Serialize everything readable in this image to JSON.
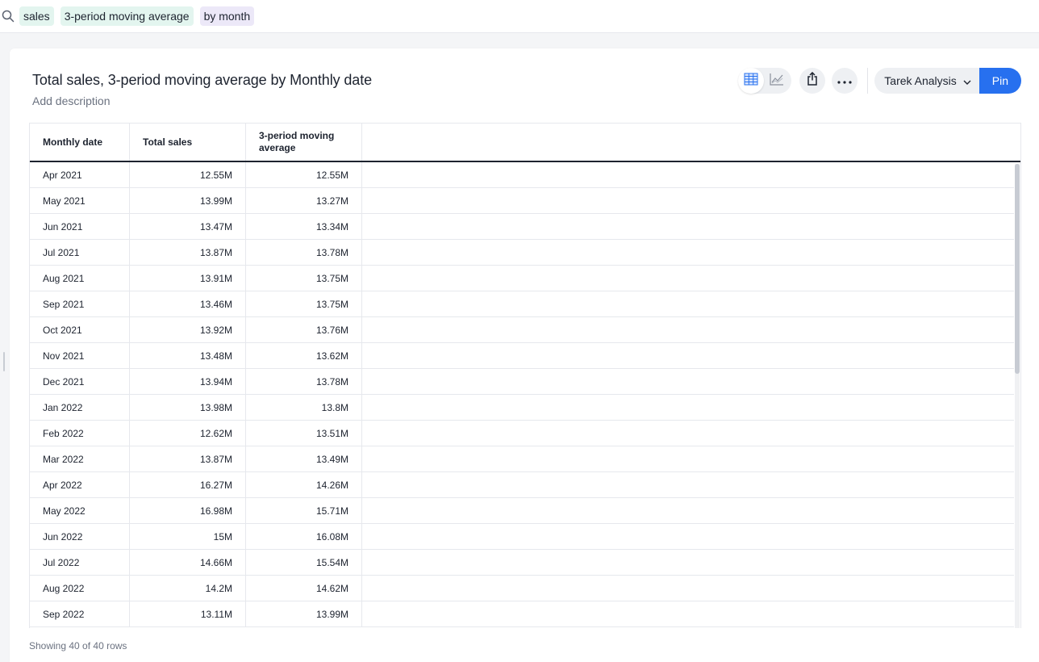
{
  "search": {
    "tokens": [
      {
        "label": "sales",
        "kind": "measure"
      },
      {
        "label": "3-period moving average",
        "kind": "measure"
      },
      {
        "label": "by month",
        "kind": "attribute"
      }
    ]
  },
  "answer": {
    "title": "Total sales, 3-period moving average by Monthly date",
    "description_placeholder": "Add description"
  },
  "toolbar": {
    "table_view_icon": "table-icon",
    "chart_view_icon": "line-chart-icon",
    "share_icon": "share-icon",
    "more_icon": "more-icon",
    "liveboard_name": "Tarek Analysis",
    "pin_label": "Pin"
  },
  "table": {
    "headers": [
      "Monthly date",
      "Total sales",
      "3-period moving average"
    ],
    "rows": [
      [
        "Apr 2021",
        "12.55M",
        "12.55M"
      ],
      [
        "May 2021",
        "13.99M",
        "13.27M"
      ],
      [
        "Jun 2021",
        "13.47M",
        "13.34M"
      ],
      [
        "Jul 2021",
        "13.87M",
        "13.78M"
      ],
      [
        "Aug 2021",
        "13.91M",
        "13.75M"
      ],
      [
        "Sep 2021",
        "13.46M",
        "13.75M"
      ],
      [
        "Oct 2021",
        "13.92M",
        "13.76M"
      ],
      [
        "Nov 2021",
        "13.48M",
        "13.62M"
      ],
      [
        "Dec 2021",
        "13.94M",
        "13.78M"
      ],
      [
        "Jan 2022",
        "13.98M",
        "13.8M"
      ],
      [
        "Feb 2022",
        "12.62M",
        "13.51M"
      ],
      [
        "Mar 2022",
        "13.87M",
        "13.49M"
      ],
      [
        "Apr 2022",
        "16.27M",
        "14.26M"
      ],
      [
        "May 2022",
        "16.98M",
        "15.71M"
      ],
      [
        "Jun 2022",
        "15M",
        "16.08M"
      ],
      [
        "Jul 2022",
        "14.66M",
        "15.54M"
      ],
      [
        "Aug 2022",
        "14.2M",
        "14.62M"
      ],
      [
        "Sep 2022",
        "13.11M",
        "13.99M"
      ]
    ],
    "footer": "Showing 40 of 40 rows"
  },
  "colors": {
    "accent": "#2770ef",
    "measure_token": "#e3f5ef",
    "attribute_token": "#ece8f8"
  }
}
